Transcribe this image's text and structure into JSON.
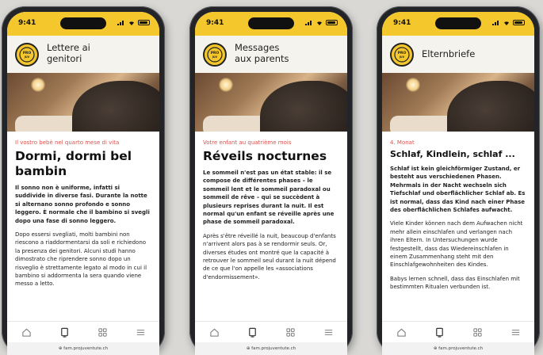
{
  "phones": [
    {
      "time": "9:41",
      "header_title": "Lettere ai\ngenitori",
      "kicker": "Il vostro bebè nel quarto mese di vita",
      "headline": "Dormi, dormi bel bambin",
      "paragraphs": [
        "Il sonno non è uniforme, infatti si suddivide in diverse fasi. Durante la notte si alternano sonno profondo e sonno leggero. È normale che il bambino si svegli dopo una fase di sonno leggero.",
        "Dopo essersi svegliati, molti bambini non riescono a riaddormentarsi da soli e richiedono la presenza dei genitori. Alcuni studi hanno dimostrato che riprendere sonno dopo un risveglio è strettamente legato al modo in cui il bambino si addormenta la sera quando viene messo a letto."
      ],
      "url": "⊕ fam.projuventute.ch"
    },
    {
      "time": "9:41",
      "header_title": "Messages\naux parents",
      "kicker": "Votre enfant au quatrième mois",
      "headline": "Réveils nocturnes",
      "paragraphs": [
        "Le sommeil n'est pas un état stable: il se compose de différentes phases – le sommeil lent et le sommeil paradoxal ou sommeil de rêve – qui se succèdent à plusieurs reprises durant la nuit. Il est normal qu'un enfant se réveille après une phase de sommeil paradoxal.",
        "Après s'être réveillé la nuit, beaucoup d'enfants n'arrivent alors pas à se rendormir seuls. Or, diverses études ont montré que la capacité à retrouver le sommeil seul durant la nuit dépend de ce que l'on appelle les «associations d'endormissement»."
      ],
      "url": "⊕ fam.projuventute.ch"
    },
    {
      "time": "9:41",
      "header_title": "Elternbriefe",
      "kicker": "4. Monat",
      "headline": "Schlaf, Kindlein, schlaf ...",
      "paragraphs": [
        "Schlaf ist kein gleichförmiger Zustand, er besteht aus verschiedenen Phasen. Mehrmals in der Nacht wechseln sich Tiefschlaf und oberflächlicher Schlaf ab. Es ist normal, dass das Kind nach einer Phase des oberflächlichen Schlafes aufwacht.",
        "Viele Kinder können nach dem Aufwachen nicht mehr allein einschlafen und verlangen nach ihren Eltern. In Untersuchungen wurde festgestellt, dass das Wiedereinschlafen in einem Zusammenhang steht mit den Einschlafgewohnheiten des Kindes.",
        "Babys lernen schnell, dass das Einschlafen mit bestimmten Ritualen verbunden ist."
      ],
      "url": "⊕ fam.projuventute.ch"
    }
  ],
  "logo_text": "PRO\nJUVENTUTE",
  "icons": [
    "home-icon",
    "tablet-icon",
    "grid-icon",
    "menu-icon"
  ],
  "colors": {
    "accent": "#f4c72c",
    "kicker": "#d9534f"
  }
}
